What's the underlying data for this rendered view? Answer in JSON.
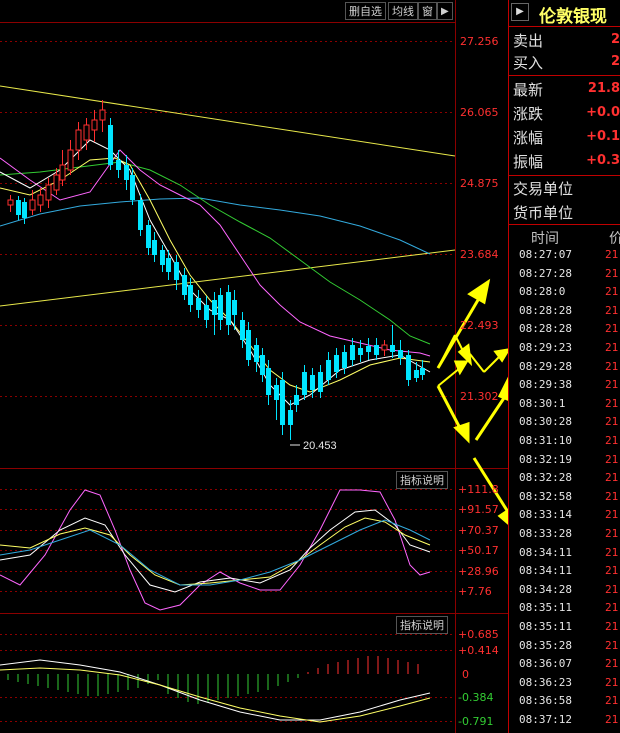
{
  "toolbar": {
    "btn_delete": "删自选",
    "btn_ma": "均线",
    "btn_window": "窗",
    "btn_arrow": "▶"
  },
  "main_chart": {
    "price_ticks": [
      "27.256",
      "26.065",
      "24.875",
      "23.684",
      "22.493",
      "21.302"
    ],
    "low_marker": "20.453"
  },
  "kdj_panel": {
    "button": "指标说明",
    "ticks": [
      "+111.8",
      "+91.57",
      "+70.37",
      "+50.17",
      "+28.96",
      "+7.76"
    ]
  },
  "macd_panel": {
    "button": "指标说明",
    "ticks": [
      "+0.685",
      "+0.414",
      "0",
      "-0.384",
      "-0.791"
    ]
  },
  "quote": {
    "title": "伦敦银现",
    "title_icon": "▶",
    "rows_top": [
      {
        "label": "卖出",
        "value": "2"
      },
      {
        "label": "买入",
        "value": "2"
      }
    ],
    "rows_mid": [
      {
        "label": "最新",
        "value": "21.8"
      },
      {
        "label": "涨跌",
        "value": "+0.0"
      },
      {
        "label": "涨幅",
        "value": "+0.1"
      },
      {
        "label": "振幅",
        "value": "+0.3"
      }
    ],
    "rows_unit": [
      {
        "label": "交易单位",
        "value": ""
      },
      {
        "label": "货币单位",
        "value": ""
      }
    ],
    "ticks_header_time": "时间",
    "ticks_header_price": "价",
    "ticks": [
      {
        "time": "08:27:07",
        "price": "21"
      },
      {
        "time": "08:27:28",
        "price": "21"
      },
      {
        "time": "08:28:0",
        "price": "21"
      },
      {
        "time": "08:28:28",
        "price": "21"
      },
      {
        "time": "08:28:28",
        "price": "21"
      },
      {
        "time": "08:29:23",
        "price": "21"
      },
      {
        "time": "08:29:28",
        "price": "21"
      },
      {
        "time": "08:29:38",
        "price": "21"
      },
      {
        "time": "08:30:1",
        "price": "21"
      },
      {
        "time": "08:30:28",
        "price": "21"
      },
      {
        "time": "08:31:10",
        "price": "21"
      },
      {
        "time": "08:32:19",
        "price": "21"
      },
      {
        "time": "08:32:28",
        "price": "21"
      },
      {
        "time": "08:32:58",
        "price": "21"
      },
      {
        "time": "08:33:14",
        "price": "21"
      },
      {
        "time": "08:33:28",
        "price": "21"
      },
      {
        "time": "08:34:11",
        "price": "21"
      },
      {
        "time": "08:34:11",
        "price": "21"
      },
      {
        "time": "08:34:28",
        "price": "21"
      },
      {
        "time": "08:35:11",
        "price": "21"
      },
      {
        "time": "08:35:11",
        "price": "21"
      },
      {
        "time": "08:35:28",
        "price": "21"
      },
      {
        "time": "08:36:07",
        "price": "21"
      },
      {
        "time": "08:36:23",
        "price": "21"
      },
      {
        "time": "08:36:58",
        "price": "21"
      },
      {
        "time": "08:37:12",
        "price": "21"
      }
    ]
  },
  "colors": {
    "up": "#ff3030",
    "down": "#00e5ff",
    "grid": "#8b0000",
    "arrow": "#ffff00",
    "ma_white": "#ffffff",
    "ma_yellow": "#ffff66",
    "ma_magenta": "#ff66ff",
    "ma_green": "#33cc33",
    "ma_cyan": "#33aadd"
  }
}
